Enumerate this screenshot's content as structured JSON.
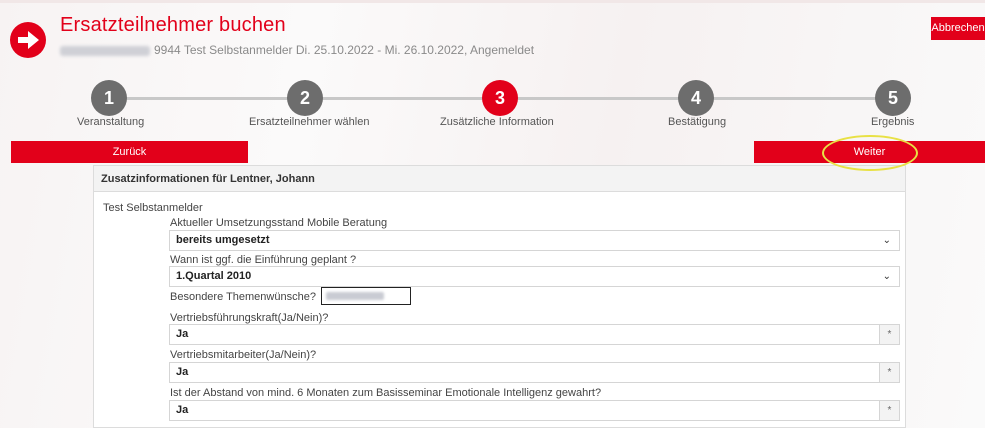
{
  "header": {
    "title": "Ersatzteilnehmer buchen",
    "subtitle": "9944 Test Selbstanmelder Di. 25.10.2022 - Mi. 26.10.2022, Angemeldet",
    "abort_label": "Abbrechen"
  },
  "steps": [
    {
      "number": "1",
      "label": "Veranstaltung"
    },
    {
      "number": "2",
      "label": "Ersatzteilnehmer wählen"
    },
    {
      "number": "3",
      "label": "Zusätzliche Information"
    },
    {
      "number": "4",
      "label": "Bestätigung"
    },
    {
      "number": "5",
      "label": "Ergebnis"
    }
  ],
  "active_step": 3,
  "nav": {
    "back_label": "Zurück",
    "next_label": "Weiter"
  },
  "panel": {
    "header": "Zusatzinformationen für Lentner, Johann",
    "section": "Test Selbstanmelder",
    "fields": [
      {
        "label": "Aktueller Umsetzungsstand Mobile Beratung",
        "value": "bereits umgesetzt"
      },
      {
        "label": "Wann ist ggf. die Einführung geplant ?",
        "value": "1.Quartal 2010"
      },
      {
        "label": "Besondere Themenwünsche?"
      },
      {
        "label": "Vertriebsführungskraft(Ja/Nein)?",
        "value": "Ja",
        "marker": "*"
      },
      {
        "label": "Vertriebsmitarbeiter(Ja/Nein)?",
        "value": "Ja",
        "marker": "*"
      },
      {
        "label": "Ist der Abstand von mind. 6 Monaten zum Basisseminar Emotionale Intelligenz gewahrt?",
        "value": "Ja",
        "marker": "*"
      }
    ]
  },
  "colors": {
    "brand": "#e2001a",
    "highlight": "#e8e145",
    "inactive_step": "#6d6d6d"
  },
  "icons": {
    "logo": "arrow-right-circle-icon",
    "select": "chevron-down-icon"
  }
}
